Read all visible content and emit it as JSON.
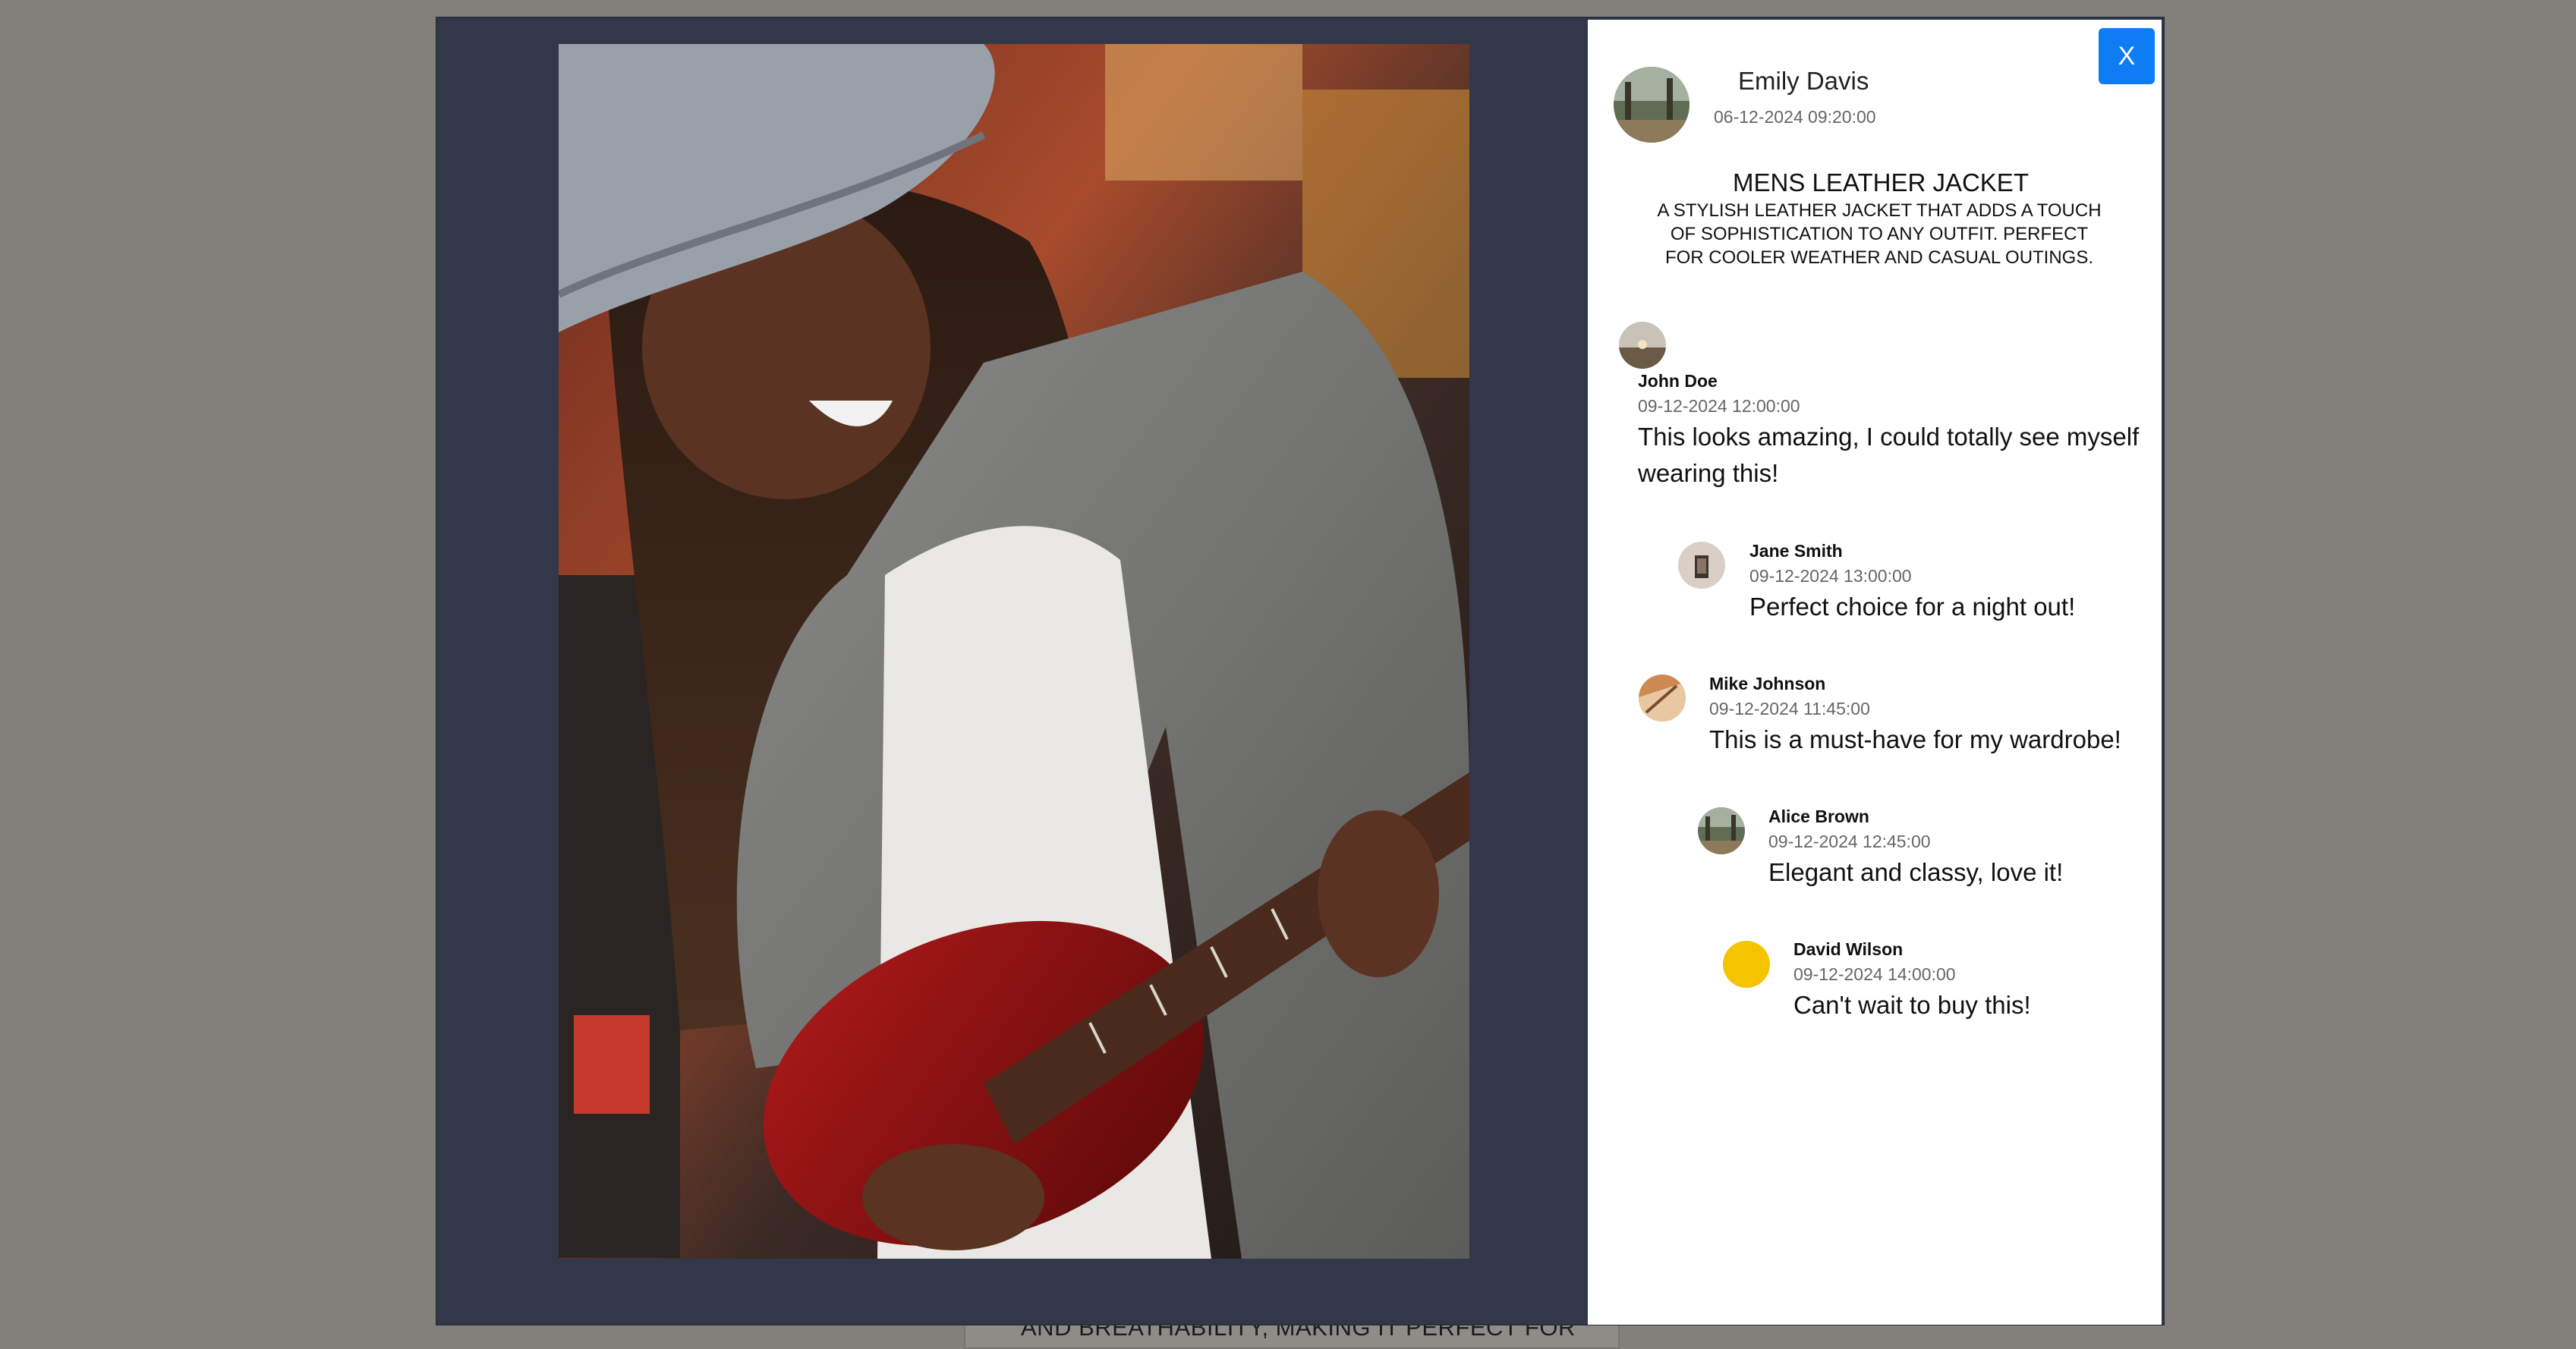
{
  "background": {
    "partial_text": "AND BREATHABILITY, MAKING IT PERFECT FOR"
  },
  "modal": {
    "close_label": "X",
    "photo": {
      "description_icon": "image-photo"
    }
  },
  "post": {
    "author": "Emily Davis",
    "date": "06-12-2024 09:20:00",
    "title": "MENS LEATHER JACKET",
    "description": "A STYLISH LEATHER JACKET THAT ADDS A TOUCH OF SOPHISTICATION TO ANY OUTFIT. PERFECT FOR COOLER WEATHER AND CASUAL OUTINGS."
  },
  "comments": [
    {
      "name": "John Doe",
      "date": "09-12-2024 12:00:00",
      "text": "This looks amazing, I could totally see myself wearing this!"
    },
    {
      "name": "Jane Smith",
      "date": "09-12-2024 13:00:00",
      "text": "Perfect choice for a night out!"
    },
    {
      "name": "Mike Johnson",
      "date": "09-12-2024 11:45:00",
      "text": "This is a must-have for my wardrobe!"
    },
    {
      "name": "Alice Brown",
      "date": "09-12-2024 12:45:00",
      "text": "Elegant and classy, love it!"
    },
    {
      "name": "David Wilson",
      "date": "09-12-2024 14:00:00",
      "text": "Can't wait to buy this!"
    }
  ],
  "colors": {
    "accent": "#0d7cf5",
    "modal_bg": "#323849",
    "overlay": "#83807c",
    "avatar_yellow": "#f5c400"
  }
}
